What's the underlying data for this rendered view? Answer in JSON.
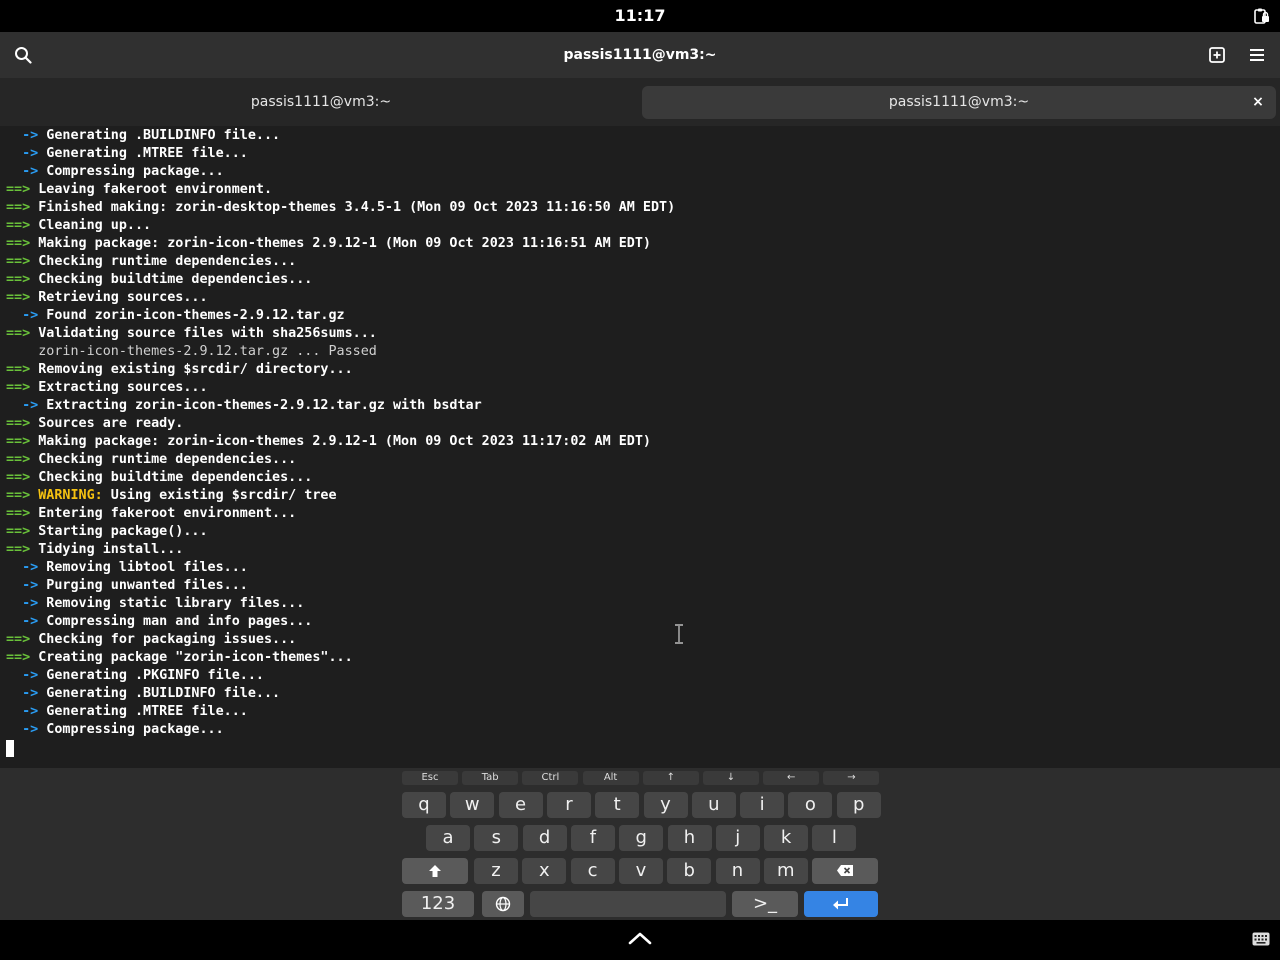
{
  "status": {
    "time": "11:17"
  },
  "window": {
    "title": "passis1111@vm3:~"
  },
  "tabs": [
    {
      "label": "passis1111@vm3:~"
    },
    {
      "label": "passis1111@vm3:~",
      "close": "×"
    }
  ],
  "terminal": {
    "lines": [
      {
        "p": "  ->",
        "t": " Generating .BUILDINFO file..."
      },
      {
        "p": "  ->",
        "t": " Generating .MTREE file..."
      },
      {
        "p": "  ->",
        "t": " Compressing package..."
      },
      {
        "p": "==>",
        "t": " Leaving fakeroot environment."
      },
      {
        "p": "==>",
        "t": " Finished making: zorin-desktop-themes 3.4.5-1 (Mon 09 Oct 2023 11:16:50 AM EDT)"
      },
      {
        "p": "==>",
        "t": " Cleaning up..."
      },
      {
        "p": "==>",
        "t": " Making package: zorin-icon-themes 2.9.12-1 (Mon 09 Oct 2023 11:16:51 AM EDT)"
      },
      {
        "p": "==>",
        "t": " Checking runtime dependencies..."
      },
      {
        "p": "==>",
        "t": " Checking buildtime dependencies..."
      },
      {
        "p": "==>",
        "t": " Retrieving sources..."
      },
      {
        "p": "  ->",
        "t": " Found zorin-icon-themes-2.9.12.tar.gz"
      },
      {
        "p": "==>",
        "t": " Validating source files with sha256sums..."
      },
      {
        "p": "",
        "t": "    zorin-icon-themes-2.9.12.tar.gz ... Passed",
        "plain": true
      },
      {
        "p": "==>",
        "t": " Removing existing $srcdir/ directory..."
      },
      {
        "p": "==>",
        "t": " Extracting sources..."
      },
      {
        "p": "  ->",
        "t": " Extracting zorin-icon-themes-2.9.12.tar.gz with bsdtar"
      },
      {
        "p": "==>",
        "t": " Sources are ready."
      },
      {
        "p": "==>",
        "t": " Making package: zorin-icon-themes 2.9.12-1 (Mon 09 Oct 2023 11:17:02 AM EDT)"
      },
      {
        "p": "==>",
        "t": " Checking runtime dependencies..."
      },
      {
        "p": "==>",
        "t": " Checking buildtime dependencies..."
      },
      {
        "p": "==>",
        "w": " WARNING:",
        "t": " Using existing $srcdir/ tree"
      },
      {
        "p": "==>",
        "t": " Entering fakeroot environment..."
      },
      {
        "p": "==>",
        "t": " Starting package()..."
      },
      {
        "p": "==>",
        "t": " Tidying install..."
      },
      {
        "p": "  ->",
        "t": " Removing libtool files..."
      },
      {
        "p": "  ->",
        "t": " Purging unwanted files..."
      },
      {
        "p": "  ->",
        "t": " Removing static library files..."
      },
      {
        "p": "  ->",
        "t": " Compressing man and info pages..."
      },
      {
        "p": "==>",
        "t": " Checking for packaging issues..."
      },
      {
        "p": "==>",
        "t": " Creating package \"zorin-icon-themes\"..."
      },
      {
        "p": "  ->",
        "t": " Generating .PKGINFO file..."
      },
      {
        "p": "  ->",
        "t": " Generating .BUILDINFO file..."
      },
      {
        "p": "  ->",
        "t": " Generating .MTREE file..."
      },
      {
        "p": "  ->",
        "t": " Compressing package..."
      }
    ]
  },
  "keyboard": {
    "extra_keys": [
      "Esc",
      "Tab",
      "Ctrl",
      "Alt",
      "↑",
      "↓",
      "←",
      "→"
    ],
    "row1": [
      "q",
      "w",
      "e",
      "r",
      "t",
      "y",
      "u",
      "i",
      "o",
      "p"
    ],
    "row2": [
      "a",
      "s",
      "d",
      "f",
      "g",
      "h",
      "j",
      "k",
      "l"
    ],
    "row3": [
      "z",
      "x",
      "c",
      "v",
      "b",
      "n",
      "m"
    ],
    "numbers_label": "123",
    "terminal_label": ">_"
  },
  "icons": {
    "search": "search-icon",
    "new_tab": "new-tab-icon",
    "menu": "hamburger-menu-icon",
    "lock": "clipboard-lock-icon",
    "keyboard": "keyboard-icon"
  },
  "colors": {
    "prompt_blue": "#2a9df4",
    "arrow_green": "#6ac23a",
    "warning_yellow": "#f5c211",
    "enter_blue": "#3584e4"
  }
}
